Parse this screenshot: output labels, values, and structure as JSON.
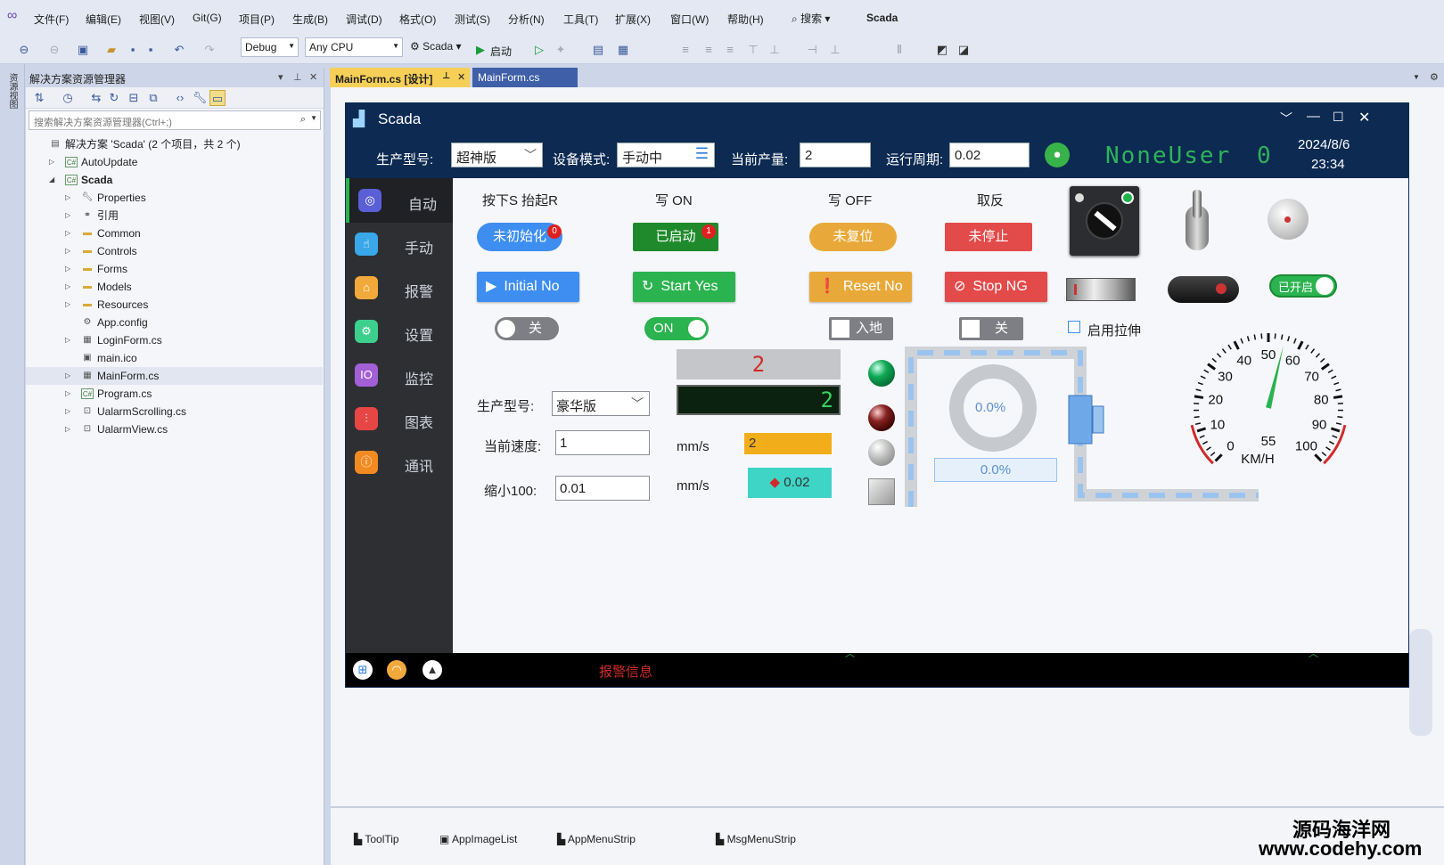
{
  "menu": {
    "items": [
      "文件(F)",
      "编辑(E)",
      "视图(V)",
      "Git(G)",
      "项目(P)",
      "生成(B)",
      "调试(D)",
      "格式(O)",
      "测试(S)",
      "分析(N)",
      "工具(T)",
      "扩展(X)",
      "窗口(W)",
      "帮助(H)"
    ],
    "search": "搜索",
    "solution_name": "Scada"
  },
  "toolbar": {
    "config": "Debug",
    "platform": "Any CPU",
    "project": "Scada",
    "start": "启动"
  },
  "left_tab": "资源视图",
  "solution_explorer": {
    "title": "解决方案资源管理器",
    "search_placeholder": "搜索解决方案资源管理器(Ctrl+;)",
    "items": [
      {
        "label": "解决方案 'Scada' (2 个项目，共 2 个)",
        "icon": "sln"
      },
      {
        "label": "AutoUpdate",
        "icon": "C#"
      },
      {
        "label": "Scada",
        "icon": "C#"
      },
      {
        "label": "Properties",
        "icon": "wrench"
      },
      {
        "label": "引用",
        "icon": "ref"
      },
      {
        "label": "Common",
        "icon": "folder"
      },
      {
        "label": "Controls",
        "icon": "folder"
      },
      {
        "label": "Forms",
        "icon": "folder"
      },
      {
        "label": "Models",
        "icon": "folder"
      },
      {
        "label": "Resources",
        "icon": "folder"
      },
      {
        "label": "App.config",
        "icon": "config"
      },
      {
        "label": "LoginForm.cs",
        "icon": "form"
      },
      {
        "label": "main.ico",
        "icon": "ico"
      },
      {
        "label": "MainForm.cs",
        "icon": "form"
      },
      {
        "label": "Program.cs",
        "icon": "C#"
      },
      {
        "label": "UalarmScrolling.cs",
        "icon": "ctrl"
      },
      {
        "label": "UalarmView.cs",
        "icon": "ctrl"
      }
    ]
  },
  "tabs": {
    "active": "MainForm.cs [设计]",
    "other": "MainForm.cs"
  },
  "form": {
    "title": "Scada",
    "header": {
      "model_label": "生产型号:",
      "model_value": "超神版",
      "mode_label": "设备模式:",
      "mode_value": "手动中",
      "output_label": "当前产量:",
      "output_value": "2",
      "cycle_label": "运行周期:",
      "cycle_value": "0.02",
      "user": "NoneUser",
      "user_count": "0",
      "date": "2024/8/6",
      "time": "23:34"
    },
    "nav": [
      {
        "label": "自动",
        "color": "#5b5fd6",
        "icon": "auto-icon"
      },
      {
        "label": "手动",
        "color": "#3aa7e8",
        "icon": "hand-icon"
      },
      {
        "label": "报警",
        "color": "#f2a93b",
        "icon": "alarm-icon"
      },
      {
        "label": "设置",
        "color": "#3ccf8e",
        "icon": "settings-icon"
      },
      {
        "label": "监控",
        "color": "#a35fd6",
        "icon": "monitor-icon"
      },
      {
        "label": "图表",
        "color": "#e84545",
        "icon": "chart-icon"
      },
      {
        "label": "通讯",
        "color": "#f28a22",
        "icon": "comm-icon"
      }
    ],
    "col_headers": [
      "按下S 抬起R",
      "写 ON",
      "写 OFF",
      "取反"
    ],
    "pill_buttons": [
      {
        "label": "未初始化",
        "badge": "0"
      },
      {
        "label": "已启动",
        "badge": "1"
      },
      {
        "label": "未复位"
      },
      {
        "label": "未停止"
      }
    ],
    "icon_buttons": [
      "Initial No",
      "Start Yes",
      "Reset No",
      "Stop NG"
    ],
    "toggles": {
      "t1": "关",
      "t2": "ON",
      "c1": "入地",
      "c2": "关",
      "stretch": "启用拉伸",
      "enabled": "已开启"
    },
    "fields": {
      "model_label": "生产型号:",
      "model_value": "豪华版",
      "speed_label": "当前速度:",
      "speed_value": "1",
      "scale_label": "缩小100:",
      "scale_value": "0.01",
      "unit1": "mm/s",
      "unit2": "mm/s"
    },
    "displays": {
      "seg_red": "2",
      "seg_green": "2",
      "orange_val": "2",
      "tag_val": "0.02"
    },
    "ring": {
      "percent_text": "0.0%",
      "bar_text": "0.0%",
      "fraction": 0
    },
    "gauge": {
      "unit": "KM/H",
      "min": 0,
      "max": 100,
      "value": 55,
      "value_text": "55",
      "ticks": [
        "0",
        "10",
        "20",
        "30",
        "40",
        "50",
        "60",
        "70",
        "80",
        "90",
        "100"
      ]
    },
    "alarm_text": "报警信息"
  },
  "tray": [
    "ToolTip",
    "AppImageList",
    "AppMenuStrip",
    "MsgMenuStrip"
  ],
  "watermark": {
    "line1": "源码海洋网",
    "line2": "www.codehy.com"
  }
}
